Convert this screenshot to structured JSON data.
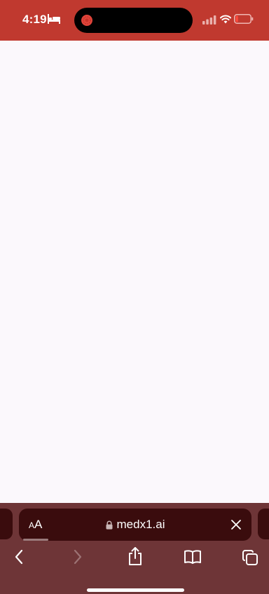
{
  "status_bar": {
    "time": "4:19",
    "background": "#c0392f"
  },
  "browser": {
    "text_size_label": "AA",
    "url": "medx1.ai",
    "toolbar_color": "#6e3537",
    "address_bar_color": "#3a0c0d"
  },
  "icons": {
    "sleep": "bed-icon",
    "recording": "screen-recording-icon",
    "signal": "cellular-signal-icon",
    "wifi": "wifi-icon",
    "battery": "battery-low-icon",
    "lock": "lock-icon",
    "close": "close-icon",
    "back": "chevron-left-icon",
    "forward": "chevron-right-icon",
    "share": "share-icon",
    "bookmarks": "open-book-icon",
    "tabs": "tabs-icon"
  }
}
